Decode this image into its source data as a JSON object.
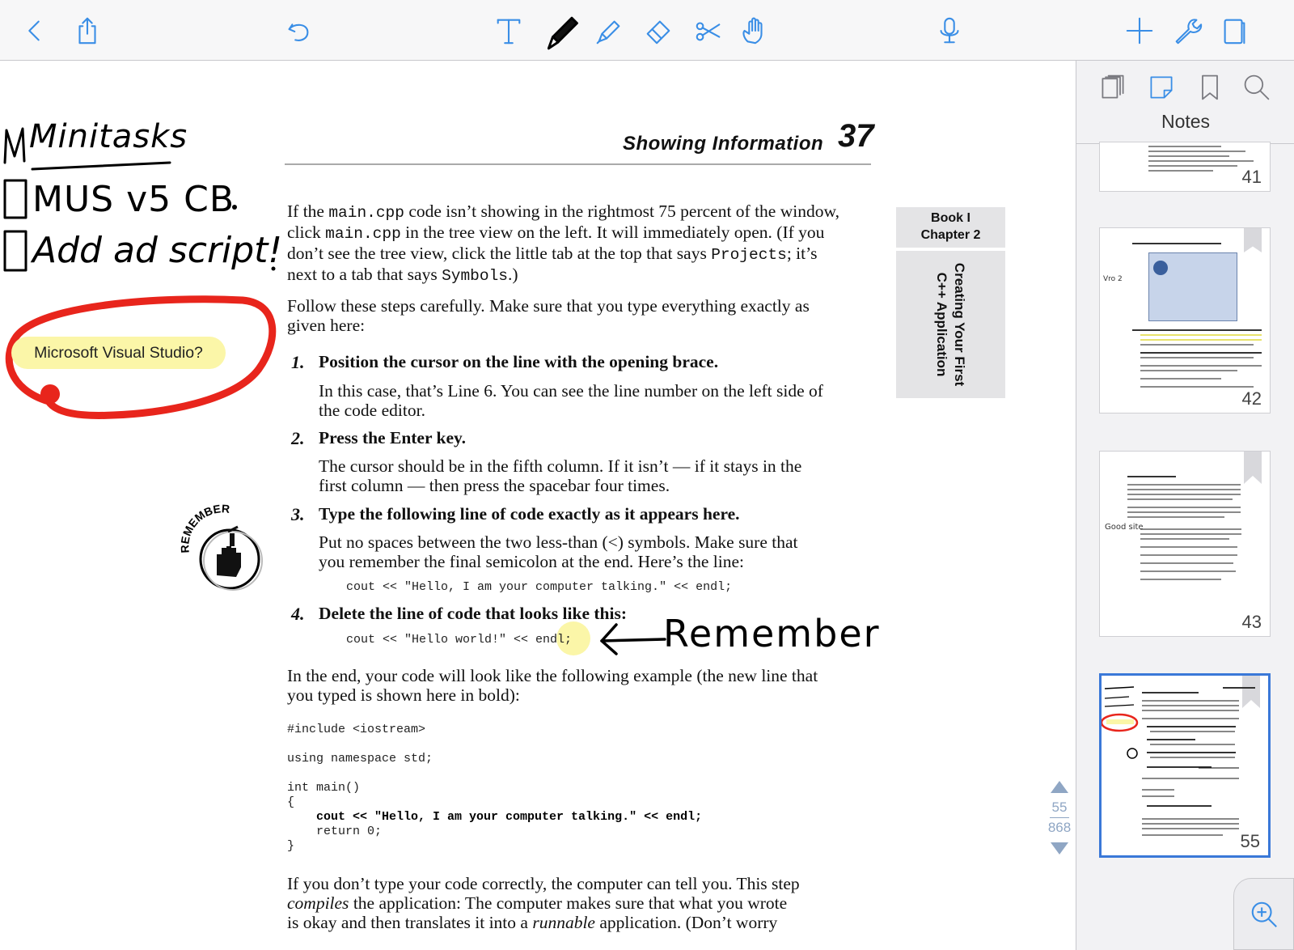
{
  "sidebar": {
    "title": "Notes",
    "thumbnails": [
      {
        "page": "41"
      },
      {
        "page": "42",
        "note": "Vro 2"
      },
      {
        "page": "43",
        "note": "Good site"
      },
      {
        "page": "55",
        "selected": true
      }
    ]
  },
  "pager": {
    "current": "55",
    "total": "868"
  },
  "document": {
    "header_title": "Showing Information",
    "header_page": "37",
    "side_tab": {
      "book": "Book I",
      "chapter": "Chapter 2",
      "vertical_line1": "Creating Your First",
      "vertical_line2": "C++ Application"
    },
    "p1": {
      "a": "If the ",
      "b": "main.cpp",
      "c": " code isn’t showing in the rightmost 75 percent of the window,",
      "d": "click ",
      "e": "main.cpp",
      "f": " in the tree view on the left. It will immediately open. (If you",
      "g": "don’t see the tree view, click the little tab at the top that says ",
      "h": "Projects",
      "i": "; it’s",
      "j": "next to a tab that says ",
      "k": "Symbols",
      "l": ".)"
    },
    "p2_line1": "Follow these steps carefully. Make sure that you type everything exactly as",
    "p2_line2": "given here:",
    "steps": [
      {
        "num": "1.",
        "title": "Position the cursor on the line with the opening brace.",
        "body1": "In this case, that’s Line 6. You can see the line number on the left side of",
        "body2": "the code editor."
      },
      {
        "num": "2.",
        "title": "Press the Enter key.",
        "body1": "The cursor should be in the fifth column. If it isn’t — if it stays in the",
        "body2": "first column — then press the spacebar four times."
      },
      {
        "num": "3.",
        "title": "Type the following line of code exactly as it appears here.",
        "body1": "Put no spaces between the two less-than (<) symbols. Make sure that",
        "body2": "you remember the final semicolon at the end. Here’s the line:",
        "code": "cout << \"Hello, I am your computer talking.\" << endl;"
      },
      {
        "num": "4.",
        "title": "Delete the line of code that looks like this:",
        "code": "cout << \"Hello world!\" << endl;"
      }
    ],
    "p3_line1": "In the end, your code will look like the following example (the new line that",
    "p3_line2": "you typed is shown here in bold):",
    "code_block": {
      "l1": "#include <iostream>",
      "l2": "using namespace std;",
      "l3": "int main()",
      "l4": "{",
      "l5": "    cout << \"Hello, I am your computer talking.\" << endl;",
      "l6": "    return 0;",
      "l7": "}"
    },
    "p4": {
      "line1": "If you don’t type your code correctly, the computer can tell you. This step",
      "l2a": "compiles",
      "l2b": " the application: The computer makes sure that what you wrote",
      "l3a": "is okay and then translates it into a ",
      "l3b": "runnable",
      "l3c": " application. (Don’t worry"
    },
    "remember_icon_label": "REMEMBER"
  },
  "annotations": {
    "sticky_note": "Microsoft Visual Studio?",
    "handwriting_title": "Minitasks",
    "handwriting_task1": "MUS v5 CB",
    "handwriting_task2": "Add ad script!",
    "handwriting_remember": "Remember",
    "colors": {
      "red_circle": "#e8251c",
      "highlight": "#fbf6a8",
      "accent": "#3a8ee6"
    }
  }
}
